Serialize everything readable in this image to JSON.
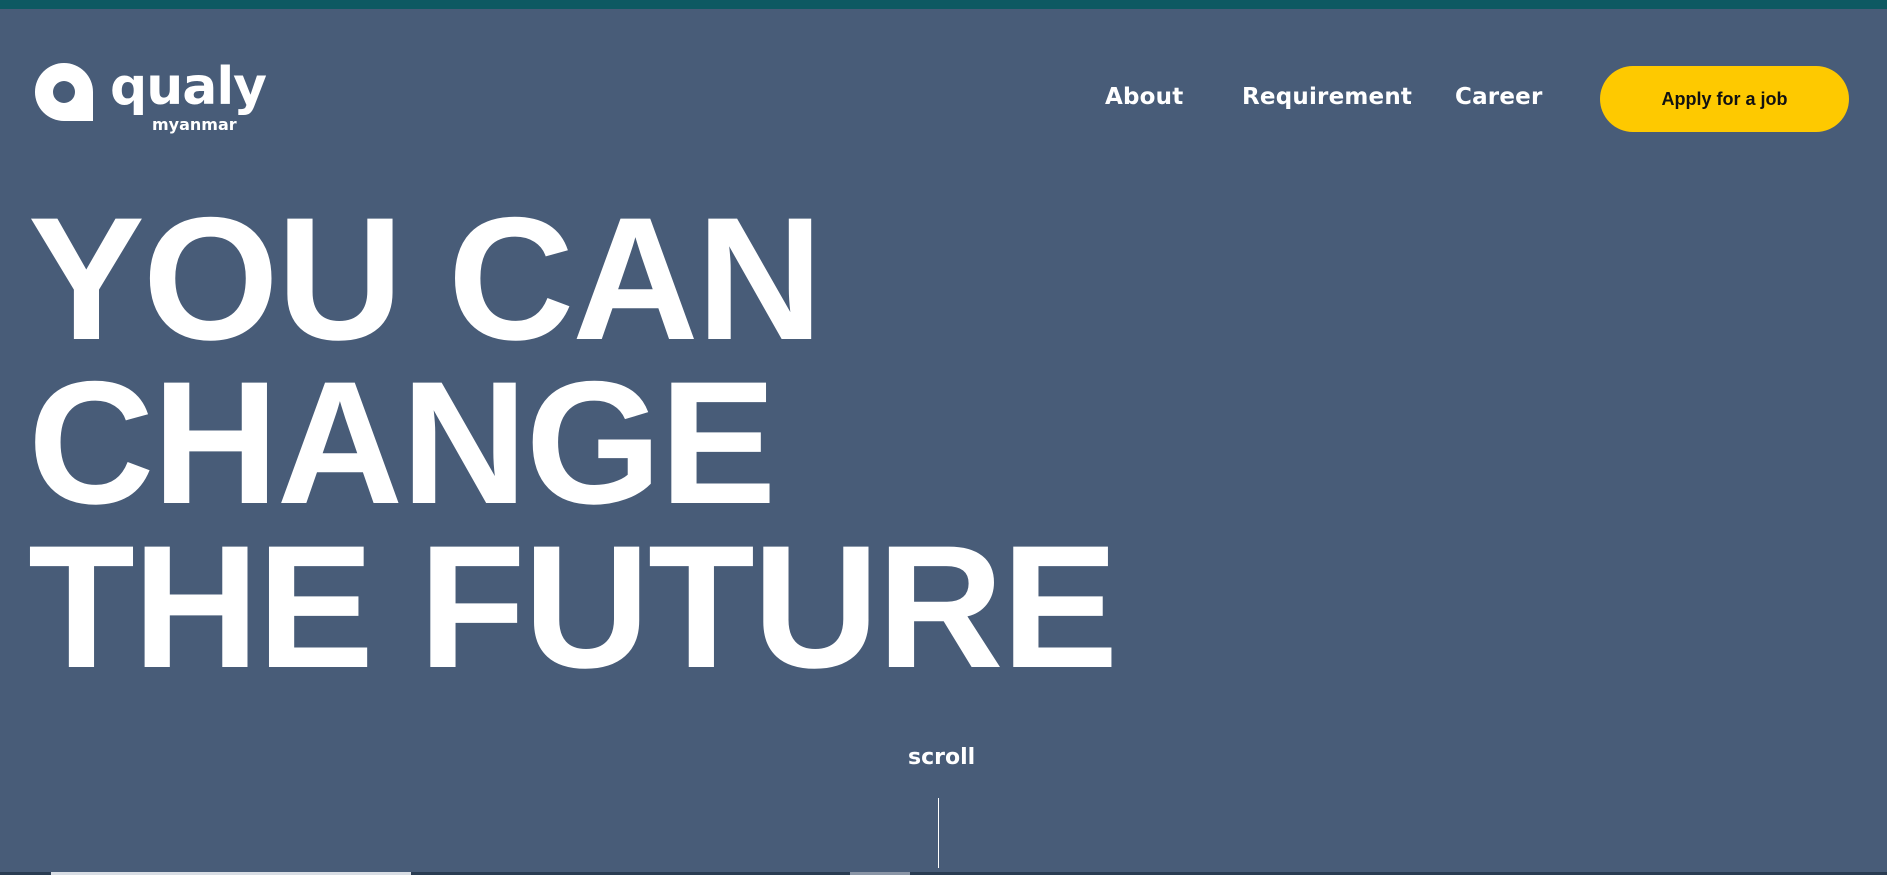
{
  "logo": {
    "brand": "qualy",
    "sub": "myanmar"
  },
  "nav": {
    "items": [
      "About",
      "Requirement",
      "Career"
    ],
    "cta": "Apply for a job"
  },
  "hero": {
    "lines": [
      "YOU CAN",
      "CHANGE",
      "THE FUTURE"
    ]
  },
  "scroll": {
    "label": "scroll"
  },
  "colors": {
    "background": "#485c78",
    "top_strip": "#0d5962",
    "accent": "#fec900",
    "text": "#ffffff"
  }
}
